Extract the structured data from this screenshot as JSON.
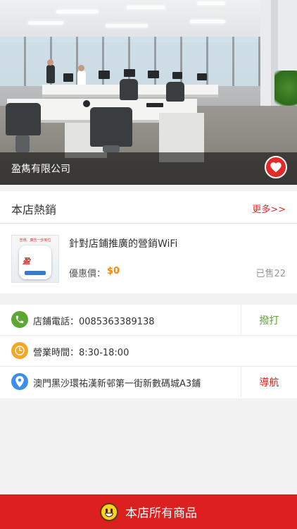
{
  "store": {
    "name": "盈雋有限公司",
    "favorite_icon": "heart-icon"
  },
  "hot": {
    "title": "本店熱銷",
    "more_label": "更多>>"
  },
  "product": {
    "thumb_caption": "宣傳、廣告一步到位",
    "thumb_logo": "盈",
    "name": "針對店鋪推廣的營銷WiFi",
    "price_label": "優惠價：",
    "price": "$0",
    "sold": "已售22"
  },
  "info": {
    "phone": {
      "icon": "phone-icon",
      "text": "店鋪電話：0085363389138",
      "action": "撥打"
    },
    "hours": {
      "icon": "clock-icon",
      "text": "營業時間：8:30-18:00"
    },
    "address": {
      "icon": "location-pin-icon",
      "text": "澳門黑沙環祐漢新邨第一街新數碼城A3鋪",
      "action": "導航"
    }
  },
  "bottom": {
    "icon": "smiley-icon",
    "label": "本店所有商品"
  },
  "colors": {
    "brand_red": "#dc1f1f",
    "price_orange": "#ff8a00",
    "call_green": "#5aa832",
    "hours_orange": "#f5a623",
    "pin_blue": "#3d8ee8"
  }
}
